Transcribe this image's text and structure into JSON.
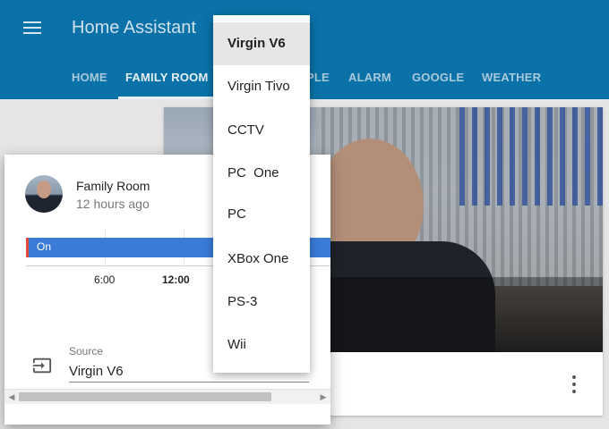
{
  "header": {
    "app_title": "Home Assistant",
    "tabs": [
      {
        "label": "HOME"
      },
      {
        "label": "FAMILY ROOM"
      },
      {
        "label": "PLE"
      },
      {
        "label": "ALARM"
      },
      {
        "label": "GOOGLE"
      },
      {
        "label": "WEATHER"
      }
    ],
    "active_tab": "FAMILY ROOM"
  },
  "camera_card": {
    "more_icon": "more-vert-icon"
  },
  "media_player": {
    "entity_name": "Family Room",
    "last_changed": "12 hours ago",
    "timeline": {
      "state_label": "On",
      "ticks": [
        "6:00",
        "12:00"
      ]
    },
    "source": {
      "label": "Source",
      "value": "Virgin V6",
      "icon": "input-icon"
    }
  },
  "dropdown": {
    "options": [
      "Virgin V6",
      "Virgin Tivo",
      "CCTV",
      "PC  One",
      "PC",
      "XBox One",
      "PS-3",
      "Wii"
    ],
    "selected": "Virgin V6"
  },
  "colors": {
    "header": "#0a72a8",
    "timeline_on": "#3a7bd8",
    "timeline_marker": "#e04a3a"
  }
}
